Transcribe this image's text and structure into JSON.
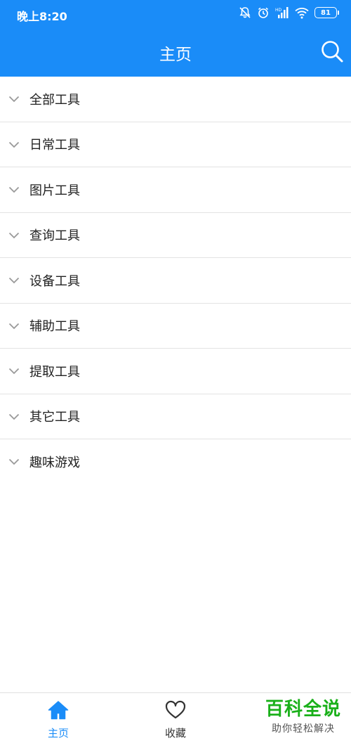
{
  "status_bar": {
    "time": "晚上8:20",
    "battery": "81",
    "icons": [
      "mute-bell-icon",
      "alarm-icon",
      "signal-icon",
      "wifi-icon",
      "battery-icon"
    ]
  },
  "app_bar": {
    "title": "主页",
    "search_icon": "search-icon"
  },
  "tools": [
    {
      "label": "全部工具"
    },
    {
      "label": "日常工具"
    },
    {
      "label": "图片工具"
    },
    {
      "label": "查询工具"
    },
    {
      "label": "设备工具"
    },
    {
      "label": "辅助工具"
    },
    {
      "label": "提取工具"
    },
    {
      "label": "其它工具"
    },
    {
      "label": "趣味游戏"
    }
  ],
  "bottom_nav": {
    "home_label": "主页",
    "favorites_label": "收藏"
  },
  "watermark": {
    "title": "百科全说",
    "subtitle": "助你轻松解决"
  },
  "colors": {
    "primary": "#1a8cf8",
    "watermark_green": "#1ab01a"
  }
}
